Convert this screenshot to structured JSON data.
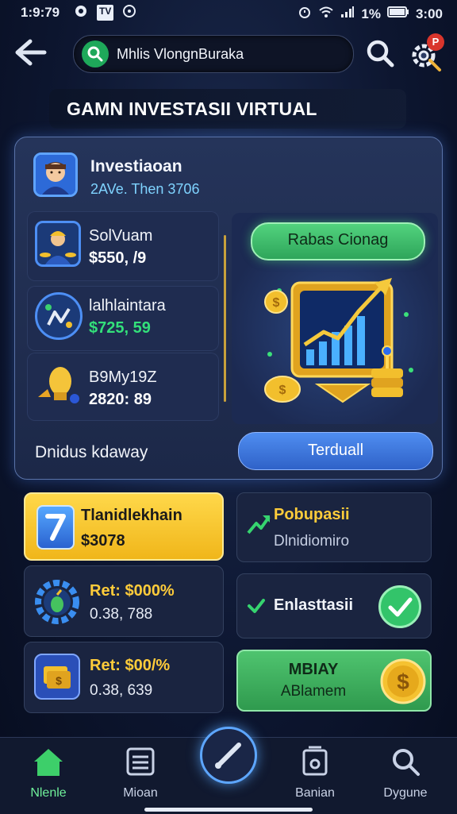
{
  "status_bar": {
    "time": "1:9:79",
    "left_icons": [
      "notification-icon",
      "tv-icon",
      "app-icon"
    ],
    "tv_label": "TV",
    "battery": "1%",
    "clock_right": "3:00"
  },
  "top_bar": {
    "search_text": "Mhlis VlongnBuraka",
    "settings_badge": "P"
  },
  "headline": "GAMN INVESTASII VIRTUAL",
  "profile": {
    "name": "Investiaoan",
    "subtitle": "2AVe. Then 3706"
  },
  "assets": [
    {
      "title": "SolVuam",
      "value": "$550, /9",
      "value_color": "white"
    },
    {
      "title": "lalhlaintara",
      "value": "$725, 59",
      "value_color": "green"
    },
    {
      "title": "B9My19Z",
      "value": "2820: 89",
      "value_color": "white"
    }
  ],
  "chart_card": {
    "button_label": "Rabas Cionag"
  },
  "footer_label": "Dnidus kdaway",
  "trade_button": "Terduall",
  "tiles": {
    "tile1": {
      "title": "Tlanidlekhain",
      "value": "$3078"
    },
    "tile2": {
      "title": "Pobupasii",
      "sub": "Dlnidiomiro"
    },
    "tile3": {
      "title": "Ret: $000%",
      "sub": "0.38, 788"
    },
    "tile4": {
      "title": "Enlasttasii"
    },
    "tile5": {
      "title": "Ret: $00/%",
      "sub": "0.38, 639"
    },
    "tile6": {
      "title": "MBIAY",
      "sub": "ABlamem"
    }
  },
  "bottom_nav": [
    {
      "label": "Nlenle",
      "icon": "home-icon"
    },
    {
      "label": "Mioan",
      "icon": "list-icon"
    },
    {
      "label": "",
      "icon": "trade-icon"
    },
    {
      "label": "Banian",
      "icon": "wallet-icon"
    },
    {
      "label": "Dygune",
      "icon": "search-icon"
    }
  ]
}
